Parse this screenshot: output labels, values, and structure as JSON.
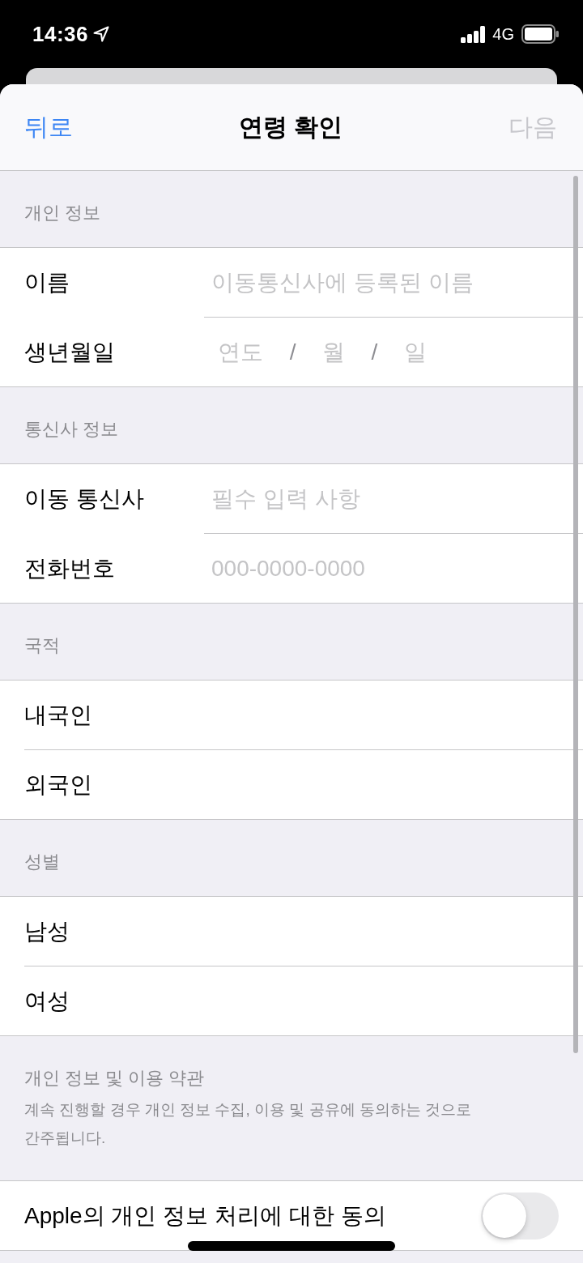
{
  "status_bar": {
    "time": "14:36",
    "network": "4G"
  },
  "nav_bar": {
    "back": "뒤로",
    "title": "연령 확인",
    "next": {
      "label": "다음",
      "disabled": true
    }
  },
  "sections": [
    {
      "header": "개인 정보",
      "rows": [
        {
          "kind": "text",
          "label": "이름",
          "placeholder": "이동통신사에 등록된 이름"
        },
        {
          "kind": "date",
          "label": "생년월일",
          "parts": [
            {
              "placeholder": "연도"
            },
            {
              "placeholder": "월"
            },
            {
              "placeholder": "일"
            }
          ],
          "separators": [
            "/",
            "/"
          ]
        }
      ]
    },
    {
      "header": "통신사 정보",
      "rows": [
        {
          "kind": "text",
          "label": "이동 통신사",
          "placeholder": "필수 입력 사항"
        },
        {
          "kind": "text",
          "label": "전화번호",
          "placeholder": "000-0000-0000"
        }
      ]
    },
    {
      "header": "국적",
      "rows": [
        {
          "kind": "choice",
          "label": "내국인",
          "selected": false
        },
        {
          "kind": "choice",
          "label": "외국인",
          "selected": false
        }
      ]
    },
    {
      "header": "성별",
      "rows": [
        {
          "kind": "choice",
          "label": "남성",
          "selected": false
        },
        {
          "kind": "choice",
          "label": "여성",
          "selected": false
        }
      ]
    },
    {
      "header": "개인 정보 및 이용 약관",
      "note": "계속 진행할 경우 개인 정보 수집, 이용 및 공유에 동의하는 것으로 간주됩니다.",
      "rows": [
        {
          "kind": "toggle",
          "label": "Apple의 개인 정보 처리에 대한 동의",
          "on": false
        }
      ]
    }
  ]
}
